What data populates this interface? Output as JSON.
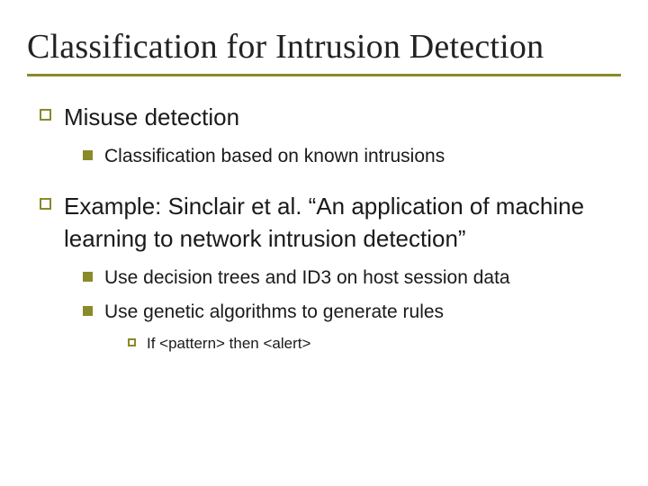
{
  "title": "Classification for Intrusion Detection",
  "bullets": {
    "b1": "Misuse detection",
    "b1_1": "Classification based on known intrusions",
    "b2": "Example: Sinclair et al. “An application of machine learning to network intrusion detection”",
    "b2_1": "Use decision trees and ID3 on host session data",
    "b2_2": "Use genetic algorithms to generate rules",
    "b2_2_1": "If <pattern> then <alert>"
  }
}
